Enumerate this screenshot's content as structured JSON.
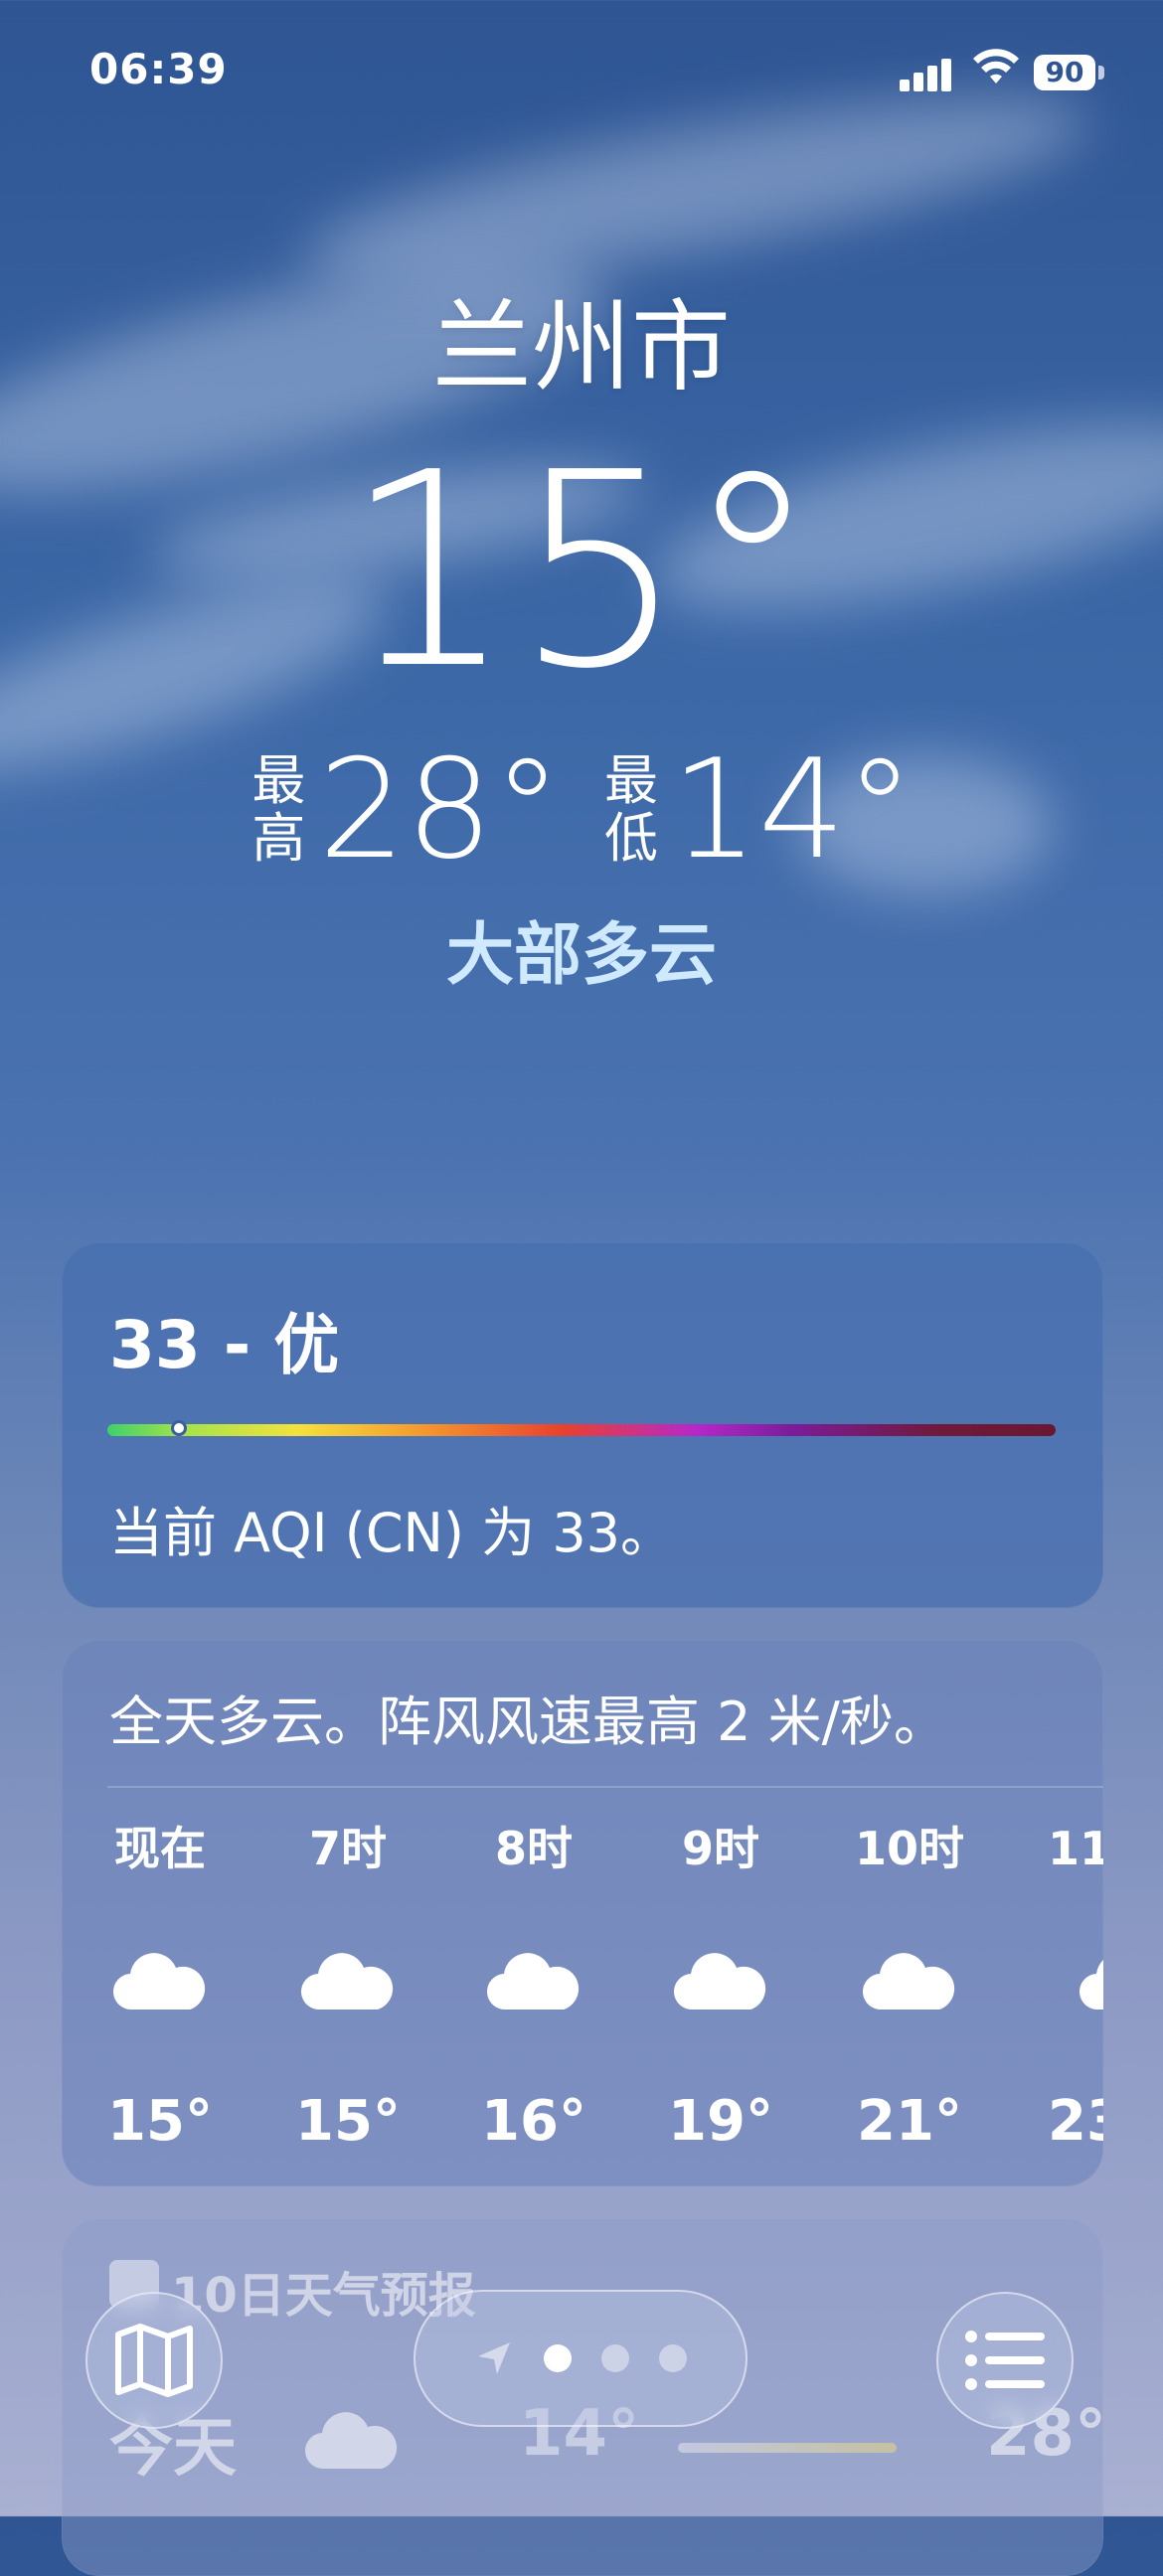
{
  "status_bar": {
    "time": "06:39",
    "battery": "90"
  },
  "header": {
    "city": "兰州市",
    "temperature": "15°",
    "high_label": "最高",
    "high_value": "28°",
    "low_label": "最低",
    "low_value": "14°",
    "condition": "大部多云"
  },
  "aqi": {
    "title": "33 - 优",
    "value": 33,
    "description": "当前 AQI (CN) 为 33。"
  },
  "hourly": {
    "summary": "全天多云。阵风风速最高 2 米/秒。",
    "items": [
      {
        "hour": "现在",
        "icon": "cloud-icon",
        "temp": "15°"
      },
      {
        "hour": "7时",
        "icon": "cloud-icon",
        "temp": "15°"
      },
      {
        "hour": "8时",
        "icon": "cloud-icon",
        "temp": "16°"
      },
      {
        "hour": "9时",
        "icon": "cloud-icon",
        "temp": "19°"
      },
      {
        "hour": "10时",
        "icon": "cloud-icon",
        "temp": "21°"
      },
      {
        "hour": "11",
        "icon": "cloud-icon",
        "temp": "23"
      }
    ]
  },
  "forecast": {
    "title": "10日天气预报",
    "today": {
      "day": "今天",
      "icon": "cloud-icon",
      "low": "14°",
      "high": "28°"
    }
  },
  "toolbar": {
    "map_icon": "map-icon",
    "list_icon": "list-icon",
    "location_icon": "location-arrow-icon"
  },
  "colors": {
    "condition_text": "#cfe9ff"
  }
}
